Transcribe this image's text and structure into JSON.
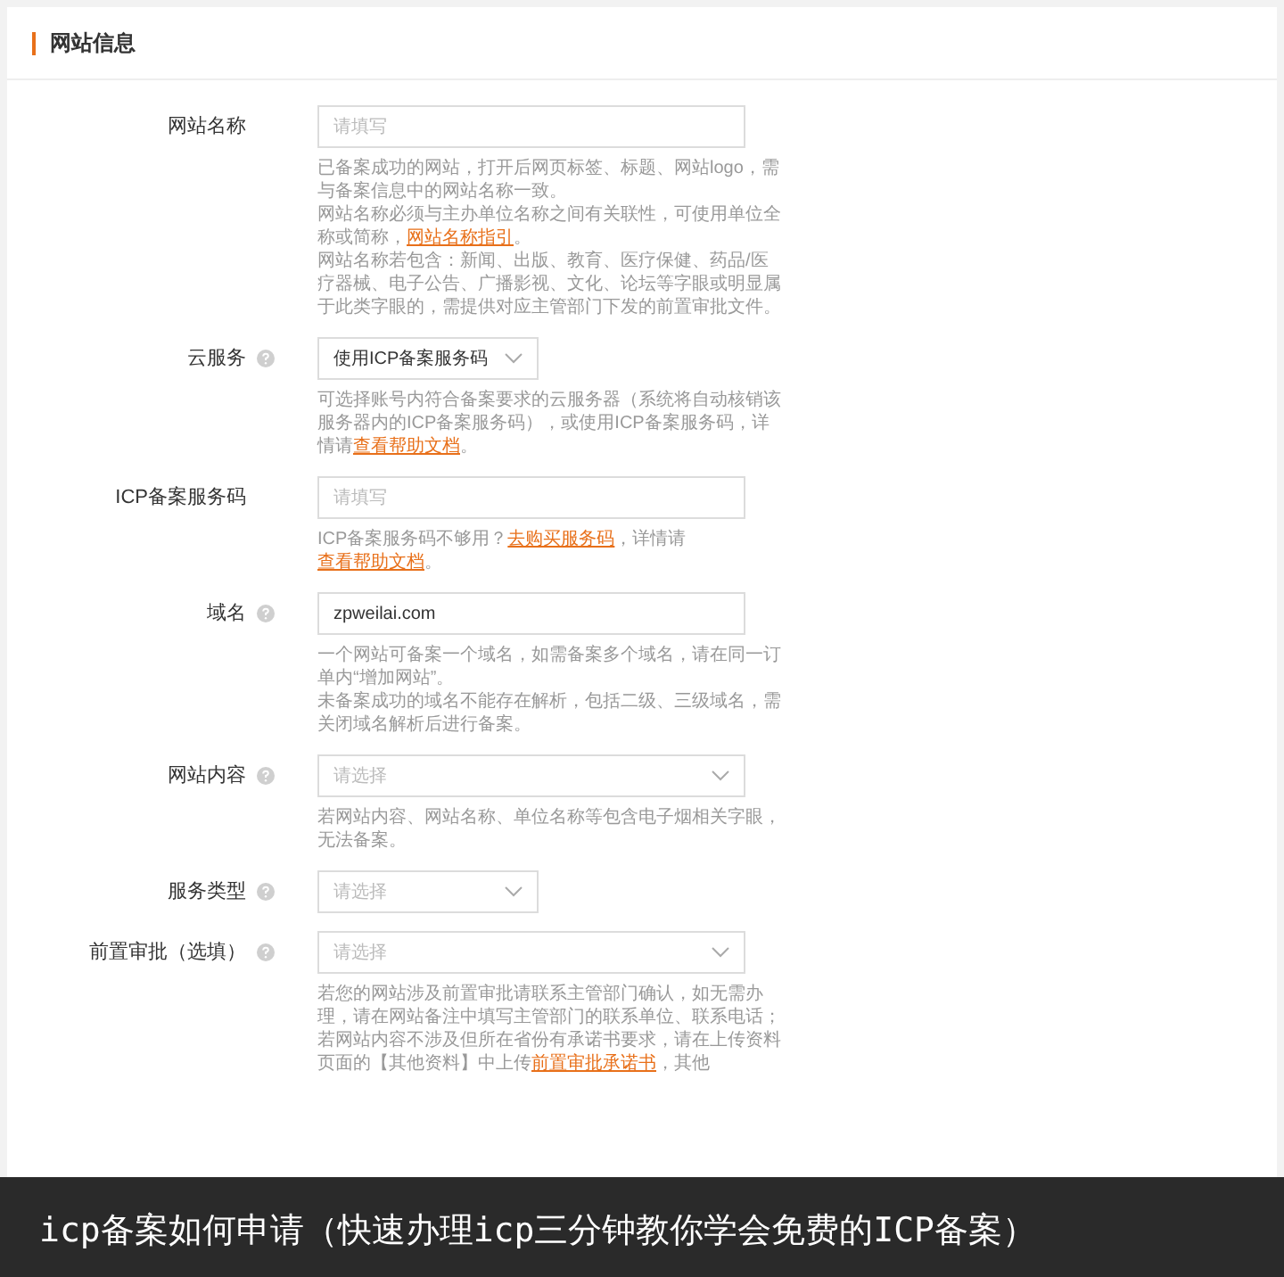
{
  "section_title": "网站信息",
  "fields": [
    {
      "label": "网站名称",
      "help_icon": false,
      "kind": "input",
      "placeholder": "请填写",
      "help": [
        {
          "kind": "text",
          "text": "已备案成功的网站，打开后网页标签、标题、网站logo，需与备案信息中的网站名称一致。"
        },
        {
          "kind": "break"
        },
        {
          "kind": "text",
          "text": "网站名称必须与主办单位名称之间有关联性，可使用单位全称或简称，"
        },
        {
          "kind": "link",
          "text": "网站名称指引"
        },
        {
          "kind": "text",
          "text": "。"
        },
        {
          "kind": "break"
        },
        {
          "kind": "text",
          "text": "网站名称若包含：新闻、出版、教育、医疗保健、药品/医疗器械、电子公告、广播影视、文化、论坛等字眼或明显属于此类字眼的，需提供对应主管部门下发的前置审批文件。"
        }
      ]
    },
    {
      "label": "云服务",
      "help_icon": true,
      "kind": "select_short",
      "value": "使用ICP备案服务码",
      "help": [
        {
          "kind": "text",
          "text": "可选择账号内符合备案要求的云服务器（系统将自动核销该服务器内的ICP备案服务码），或使用ICP备案服务码，详情请"
        },
        {
          "kind": "link",
          "text": "查看帮助文档"
        },
        {
          "kind": "text",
          "text": "。"
        }
      ]
    },
    {
      "label": "ICP备案服务码",
      "help_icon": false,
      "kind": "input",
      "placeholder": "请填写",
      "help": [
        {
          "kind": "text",
          "text": "ICP备案服务码不够用？"
        },
        {
          "kind": "link",
          "text": "去购买服务码"
        },
        {
          "kind": "text",
          "text": "，详情请"
        },
        {
          "kind": "link",
          "text": "查看帮助文档"
        },
        {
          "kind": "text",
          "text": "。"
        }
      ]
    },
    {
      "label": "域名",
      "help_icon": true,
      "kind": "input",
      "value": "zpweilai.com",
      "help": [
        {
          "kind": "text",
          "text": "一个网站可备案一个域名，如需备案多个域名，请在同一订单内“增加网站”。"
        },
        {
          "kind": "break"
        },
        {
          "kind": "text",
          "text": "未备案成功的域名不能存在解析，包括二级、三级域名，需关闭域名解析后进行备案。"
        }
      ]
    },
    {
      "label": "网站内容",
      "help_icon": true,
      "kind": "select",
      "placeholder": "请选择",
      "help": [
        {
          "kind": "text",
          "text": "若网站内容、网站名称、单位名称等包含电子烟相关字眼，无法备案。"
        }
      ]
    },
    {
      "label": "服务类型",
      "help_icon": true,
      "kind": "select_short",
      "placeholder": "请选择"
    },
    {
      "label": "前置审批（选填）",
      "help_icon": true,
      "kind": "select",
      "placeholder": "请选择",
      "help": [
        {
          "kind": "text",
          "text": "若您的网站涉及前置审批请联系主管部门确认，如无需办理，请在网站备注中填写主管部门的联系单位、联系电话；若网站内容不涉及但所在省份有承诺书要求，请在上传资料页面的【其他资料】中上传"
        },
        {
          "kind": "link",
          "text": "前置审批承诺书"
        },
        {
          "kind": "text",
          "text": "，其他"
        }
      ]
    }
  ],
  "caption": "icp备案如何申请（快速办理icp三分钟教你学会免费的ICP备案）"
}
